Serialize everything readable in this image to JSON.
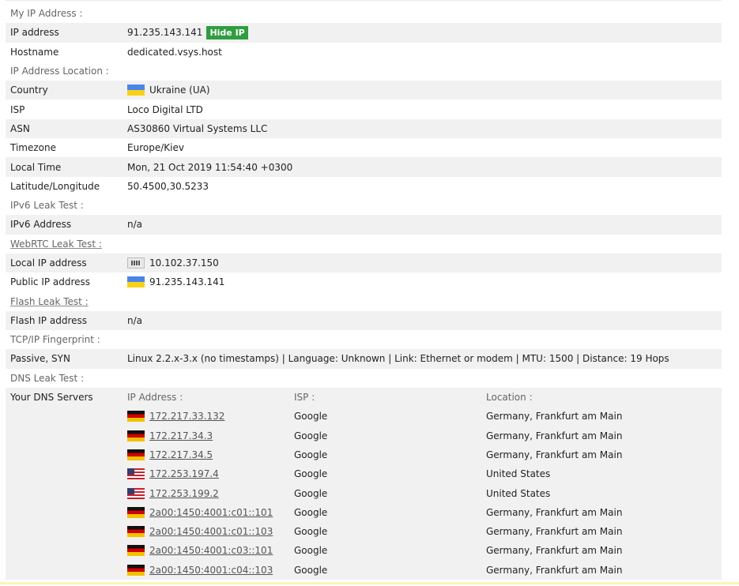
{
  "sections": {
    "my_ip": "My IP Address :",
    "ip_location": "IP Address Location :",
    "ipv6": "IPv6 Leak Test :",
    "webrtc": "WebRTC Leak Test :",
    "flash": "Flash Leak Test :",
    "tcpip": "TCP/IP Fingerprint :",
    "dns": "DNS Leak Test :"
  },
  "my_ip": {
    "ip_label": "IP address",
    "ip_value": "91.235.143.141",
    "hide_label": "Hide IP",
    "host_label": "Hostname",
    "host_value": "dedicated.vsys.host"
  },
  "location": {
    "country_label": "Country",
    "country_value": "Ukraine (UA)",
    "isp_label": "ISP",
    "isp_value": "Loco Digital LTD",
    "asn_label": "ASN",
    "asn_value": "AS30860 Virtual Systems LLC",
    "tz_label": "Timezone",
    "tz_value": "Europe/Kiev",
    "time_label": "Local Time",
    "time_value": "Mon, 21 Oct 2019 11:54:40 +0300",
    "latlon_label": "Latitude/Longitude",
    "latlon_value": "50.4500,30.5233"
  },
  "ipv6": {
    "label": "IPv6 Address",
    "value": "n/a"
  },
  "webrtc": {
    "local_label": "Local IP address",
    "local_value": "10.102.37.150",
    "public_label": "Public IP address",
    "public_value": "91.235.143.141"
  },
  "flash": {
    "label": "Flash IP address",
    "value": "n/a"
  },
  "tcpip": {
    "label": "Passive, SYN",
    "value": "Linux 2.2.x-3.x (no timestamps) | Language: Unknown | Link: Ethernet or modem | MTU: 1500 | Distance: 19 Hops"
  },
  "dns": {
    "label": "Your DNS Servers",
    "headers": {
      "ip": "IP Address :",
      "isp": "ISP :",
      "location": "Location :"
    },
    "servers": [
      {
        "flag": "de",
        "ip": "172.217.33.132",
        "isp": "Google",
        "location": "Germany, Frankfurt am Main"
      },
      {
        "flag": "de",
        "ip": "172.217.34.3",
        "isp": "Google",
        "location": "Germany, Frankfurt am Main"
      },
      {
        "flag": "de",
        "ip": "172.217.34.5",
        "isp": "Google",
        "location": "Germany, Frankfurt am Main"
      },
      {
        "flag": "us",
        "ip": "172.253.197.4",
        "isp": "Google",
        "location": "United States"
      },
      {
        "flag": "us",
        "ip": "172.253.199.2",
        "isp": "Google",
        "location": "United States"
      },
      {
        "flag": "de",
        "ip": "2a00:1450:4001:c01::101",
        "isp": "Google",
        "location": "Germany, Frankfurt am Main"
      },
      {
        "flag": "de",
        "ip": "2a00:1450:4001:c01::103",
        "isp": "Google",
        "location": "Germany, Frankfurt am Main"
      },
      {
        "flag": "de",
        "ip": "2a00:1450:4001:c03::101",
        "isp": "Google",
        "location": "Germany, Frankfurt am Main"
      },
      {
        "flag": "de",
        "ip": "2a00:1450:4001:c04::103",
        "isp": "Google",
        "location": "Germany, Frankfurt am Main"
      }
    ]
  },
  "colors": {
    "badge": "#2e9e3e",
    "alt_row": "#f1f1f1",
    "bottom_bar": "#fbf3b8"
  },
  "icons": {
    "ua": "ukraine-flag-icon",
    "de": "germany-flag-icon",
    "us": "usa-flag-icon",
    "lan": "network-card-icon"
  }
}
